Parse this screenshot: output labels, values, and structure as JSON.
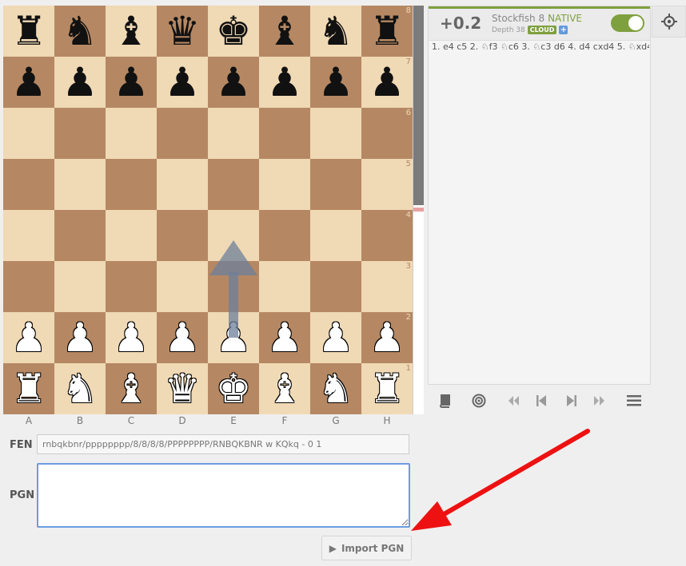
{
  "board": {
    "ranks": [
      [
        "♜",
        "♞",
        "♝",
        "♛",
        "♚",
        "♝",
        "♞",
        "♜"
      ],
      [
        "♟",
        "♟",
        "♟",
        "♟",
        "♟",
        "♟",
        "♟",
        "♟"
      ],
      [
        "",
        "",
        "",
        "",
        "",
        "",
        "",
        ""
      ],
      [
        "",
        "",
        "",
        "",
        "",
        "",
        "",
        ""
      ],
      [
        "",
        "",
        "",
        "",
        "",
        "",
        "",
        ""
      ],
      [
        "",
        "",
        "",
        "",
        "",
        "",
        "",
        ""
      ],
      [
        "♟",
        "♟",
        "♟",
        "♟",
        "♟",
        "♟",
        "♟",
        "♟"
      ],
      [
        "♜",
        "♞",
        "♝",
        "♛",
        "♚",
        "♝",
        "♞",
        "♜"
      ]
    ],
    "colors": [
      [
        "b",
        "b",
        "b",
        "b",
        "b",
        "b",
        "b",
        "b"
      ],
      [
        "b",
        "b",
        "b",
        "b",
        "b",
        "b",
        "b",
        "b"
      ],
      [
        "",
        "",
        "",
        "",
        "",
        "",
        "",
        ""
      ],
      [
        "",
        "",
        "",
        "",
        "",
        "",
        "",
        ""
      ],
      [
        "",
        "",
        "",
        "",
        "",
        "",
        "",
        ""
      ],
      [
        "",
        "",
        "",
        "",
        "",
        "",
        "",
        ""
      ],
      [
        "w",
        "w",
        "w",
        "w",
        "w",
        "w",
        "w",
        "w"
      ],
      [
        "w",
        "w",
        "w",
        "w",
        "w",
        "w",
        "w",
        "w"
      ]
    ],
    "rank_labels": [
      "8",
      "7",
      "6",
      "5",
      "4",
      "3",
      "2",
      "1"
    ],
    "file_labels": [
      "A",
      "B",
      "C",
      "D",
      "E",
      "F",
      "G",
      "H"
    ],
    "light_color": "#f0d9b5",
    "dark_color": "#b58863"
  },
  "fen": {
    "label": "FEN",
    "value": "rnbqkbnr/pppppppp/8/8/8/8/PPPPPPPP/RNBQKBNR w KQkq - 0 1"
  },
  "pgn": {
    "label": "PGN",
    "value": ""
  },
  "import_button": {
    "label": "Import PGN"
  },
  "engine": {
    "eval": "+0.2",
    "name": "Stockfish 8",
    "mode": "NATIVE",
    "depth": "Depth 38",
    "cloud": "CLOUD",
    "plus": "+",
    "pv": "1. e4 c5 2. ♘f3 ♘c6 3. ♘c3 d6 4. d4 cxd4 5. ♘xd4…",
    "accent_color": "#7fa03f"
  }
}
